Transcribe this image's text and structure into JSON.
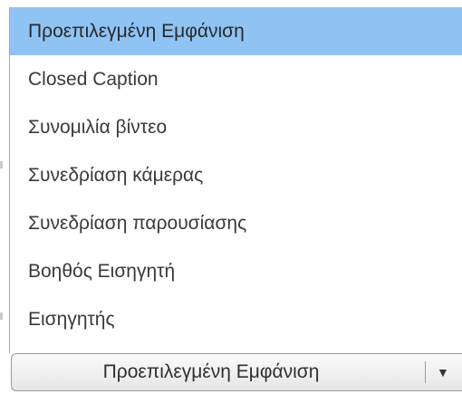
{
  "dropdown": {
    "options": [
      {
        "label": "Προεπιλεγμένη Εμφάνιση",
        "selected": true
      },
      {
        "label": "Closed Caption",
        "selected": false
      },
      {
        "label": "Συνομιλία βίντεο",
        "selected": false
      },
      {
        "label": "Συνεδρίαση κάμερας",
        "selected": false
      },
      {
        "label": "Συνεδρίαση παρουσίασης",
        "selected": false
      },
      {
        "label": "Βοηθός Εισηγητή",
        "selected": false
      },
      {
        "label": "Εισηγητής",
        "selected": false
      }
    ],
    "selected_value": "Προεπιλεγμένη Εμφάνιση",
    "arrow_icon": "chevron-down-icon"
  },
  "colors": {
    "highlight": "#8ec3f4",
    "text": "#3a3a3a",
    "border": "#9a9a9a"
  }
}
